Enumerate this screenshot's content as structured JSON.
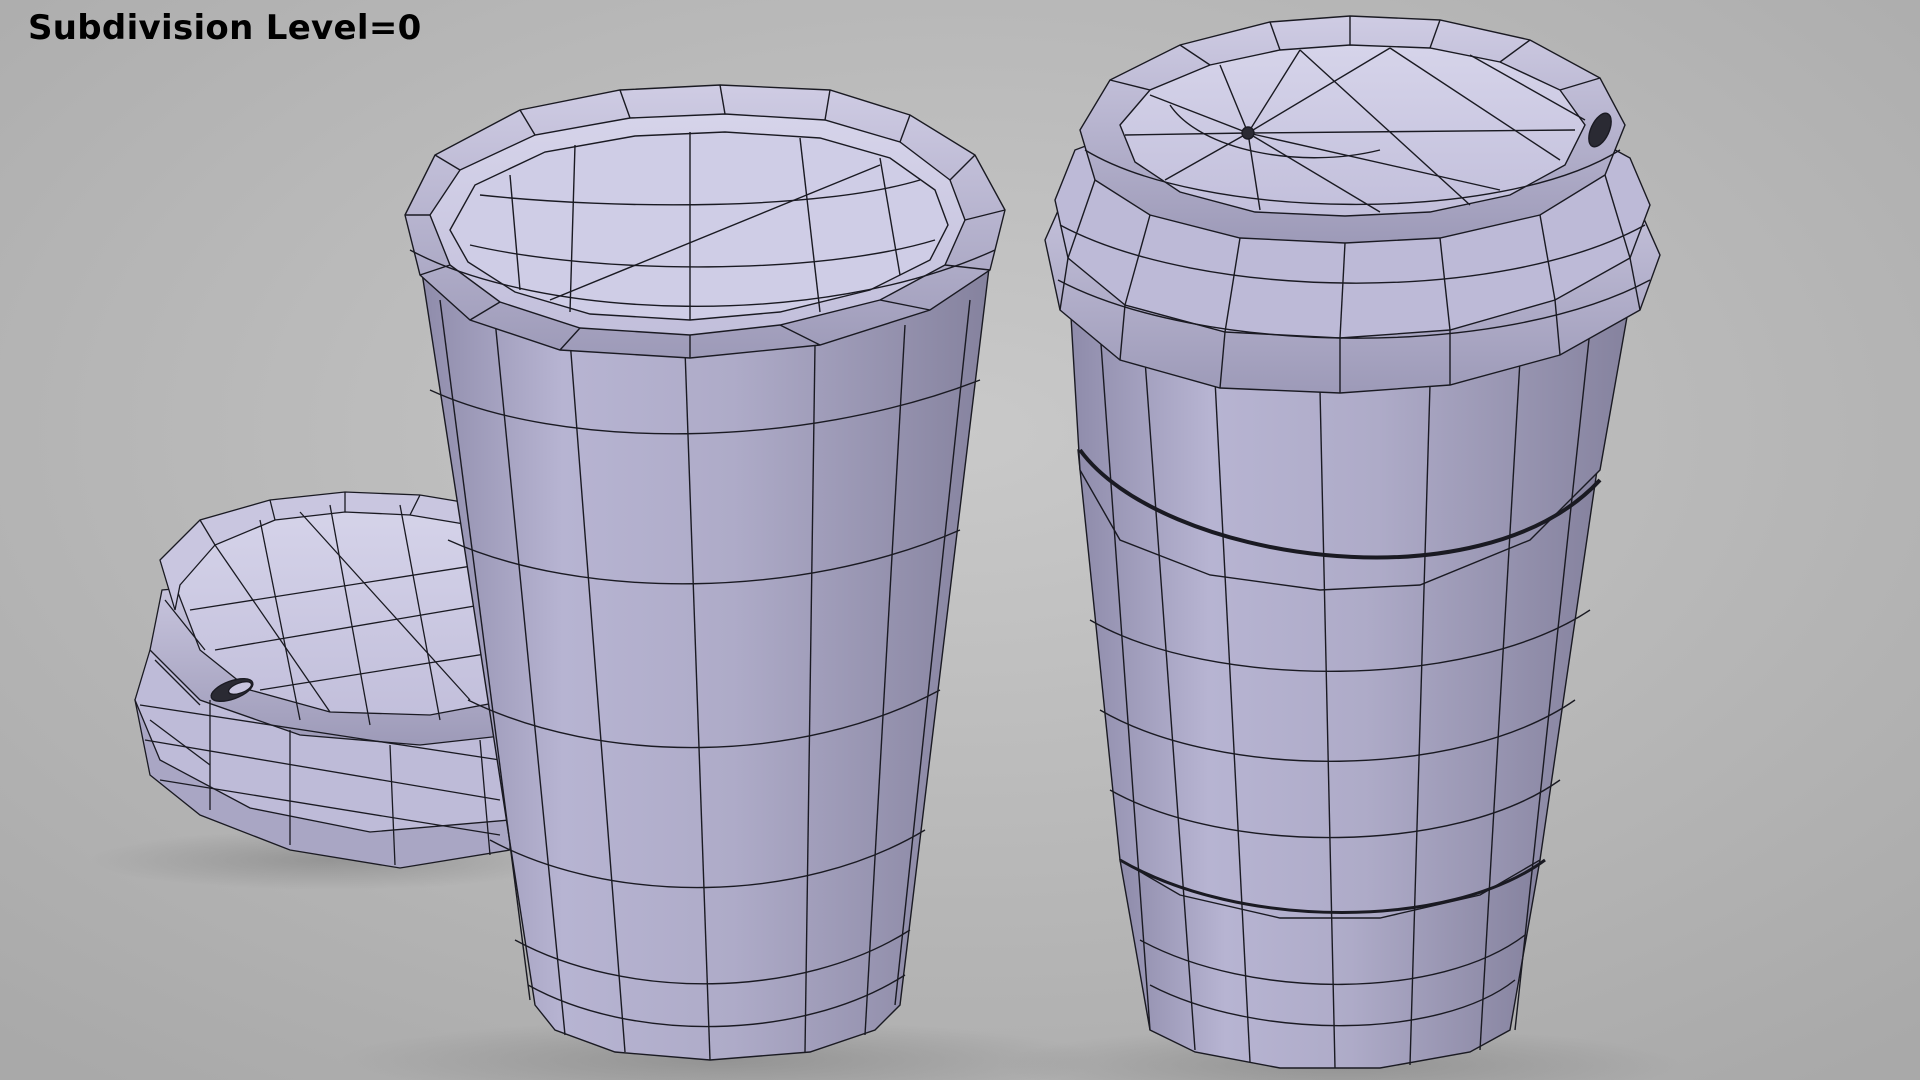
{
  "overlay": {
    "label": "Subdivision Level=0"
  },
  "scene": {
    "objects": [
      {
        "name": "loose-lid",
        "kind": "lid"
      },
      {
        "name": "open-cup",
        "kind": "cup"
      },
      {
        "name": "lidded-cup-with-sleeve",
        "kind": "cup"
      }
    ]
  },
  "colors": {
    "background": "#b9b9b9",
    "model_fill": "#b9b6d4",
    "model_light": "#d2d0e6",
    "model_shade": "#8d8aa8",
    "wire": "#1a1a22",
    "label": "#000000"
  }
}
